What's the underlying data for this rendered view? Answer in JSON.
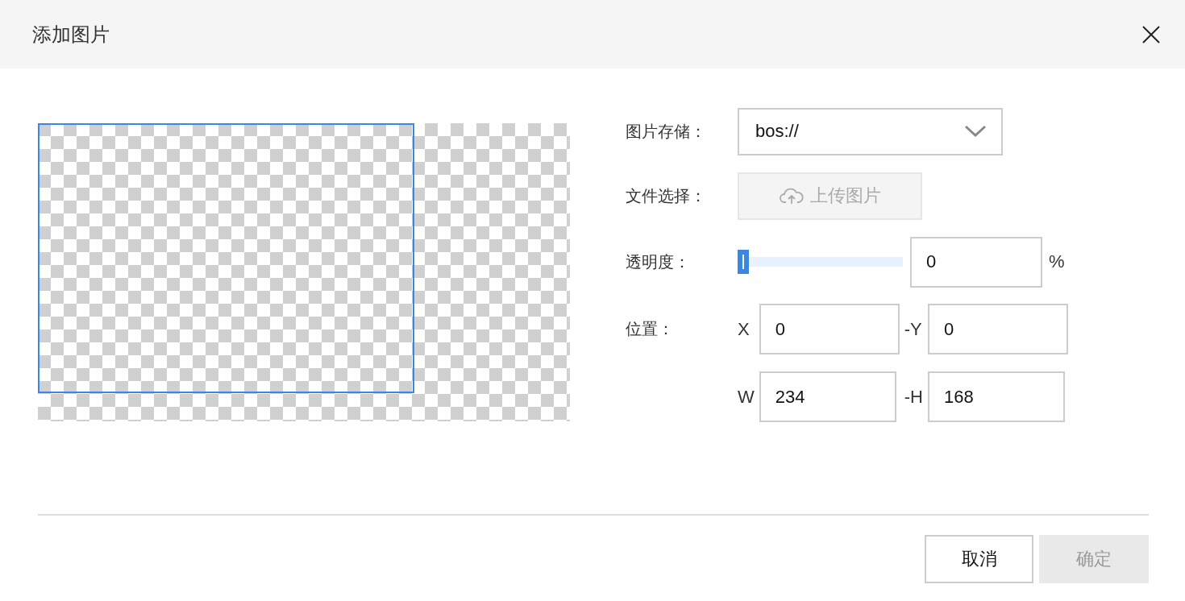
{
  "dialog": {
    "title": "添加图片"
  },
  "form": {
    "storage": {
      "label": "图片存储：",
      "value": "bos://"
    },
    "file": {
      "label": "文件选择：",
      "button": "上传图片",
      "disabled": true
    },
    "opacity": {
      "label": "透明度：",
      "level": 0,
      "value": "0",
      "unit": "%"
    },
    "position": {
      "label": "位置：",
      "fields": [
        {
          "label": "X",
          "value": "0"
        },
        {
          "label": "-Y",
          "value": "0"
        },
        {
          "label": "W",
          "value": "234"
        },
        {
          "label": "-H",
          "value": "168"
        }
      ]
    }
  },
  "buttons": [
    {
      "label": "取消",
      "disabled": false
    },
    {
      "label": "确定",
      "disabled": true
    }
  ]
}
